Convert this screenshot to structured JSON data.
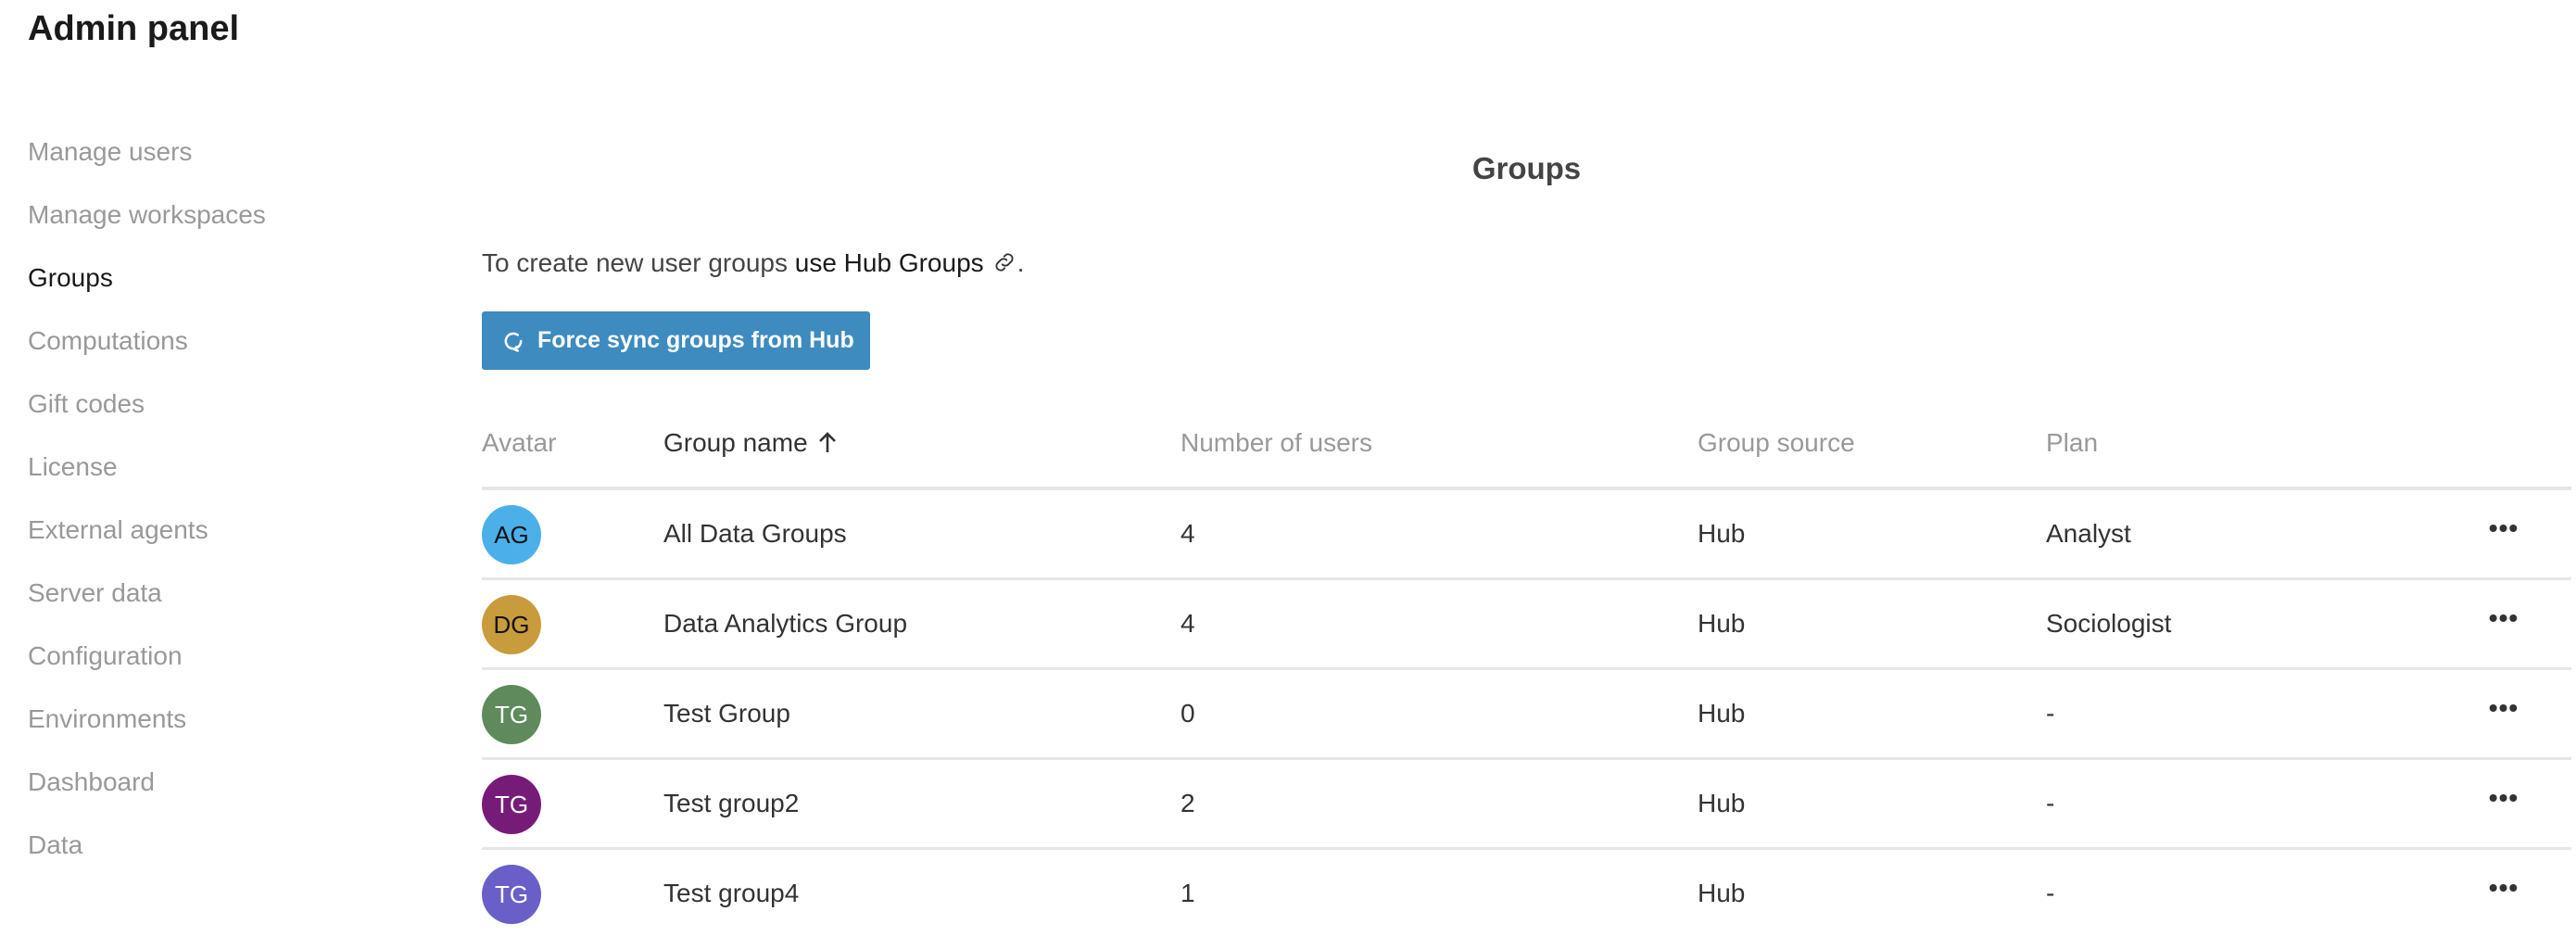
{
  "app": {
    "title": "Admin panel"
  },
  "sidebar": {
    "items": [
      {
        "label": "Manage users",
        "active": false
      },
      {
        "label": "Manage workspaces",
        "active": false
      },
      {
        "label": "Groups",
        "active": true
      },
      {
        "label": "Computations",
        "active": false
      },
      {
        "label": "Gift codes",
        "active": false
      },
      {
        "label": "License",
        "active": false
      },
      {
        "label": "External agents",
        "active": false
      },
      {
        "label": "Server data",
        "active": false
      },
      {
        "label": "Configuration",
        "active": false
      },
      {
        "label": "Environments",
        "active": false
      },
      {
        "label": "Dashboard",
        "active": false
      },
      {
        "label": "Data",
        "active": false
      }
    ]
  },
  "main": {
    "heading": "Groups",
    "info_text": "To create new user groups ",
    "info_link": "use Hub Groups",
    "info_suffix": ".",
    "link_icon": "link-icon",
    "sync_button": {
      "label": "Force sync groups from Hub",
      "icon": "refresh-icon",
      "color": "#3d8bbf"
    }
  },
  "table": {
    "columns": [
      "Avatar",
      "Group name",
      "Number of users",
      "Group source",
      "Plan"
    ],
    "sorted_column": "Group name",
    "sort_direction": "ascending",
    "rows": [
      {
        "initials": "AG",
        "avatar_color": "#4bb0ea",
        "name": "All Data Groups",
        "users": "4",
        "source": "Hub",
        "plan": "Analyst",
        "menu_icon": "more-icon"
      },
      {
        "initials": "DG",
        "avatar_color": "#c89b3c",
        "name": "Data Analytics Group",
        "users": "4",
        "source": "Hub",
        "plan": "Sociologist",
        "menu_icon": "more-icon"
      },
      {
        "initials": "TG",
        "avatar_color": "#5e8a5c",
        "name": "Test Group",
        "users": "0",
        "source": "Hub",
        "plan": "-",
        "menu_icon": "more-icon"
      },
      {
        "initials": "TG",
        "avatar_color": "#761c78",
        "name": "Test group2",
        "users": "2",
        "source": "Hub",
        "plan": "-",
        "menu_icon": "more-icon"
      },
      {
        "initials": "TG",
        "avatar_color": "#6a5fc8",
        "name": "Test group4",
        "users": "1",
        "source": "Hub",
        "plan": "-",
        "menu_icon": "more-icon"
      }
    ]
  }
}
